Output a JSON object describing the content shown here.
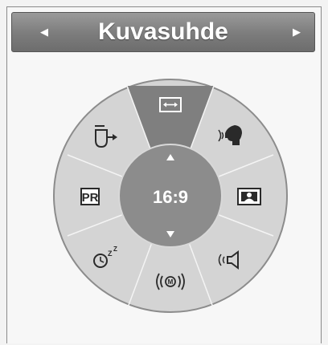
{
  "title": "Kuvasuhde",
  "nav": {
    "prev_icon": "triangle-left-icon",
    "next_icon": "triangle-right-icon"
  },
  "current_value": "16:9",
  "hub": {
    "up_icon": "triangle-up-icon",
    "down_icon": "triangle-down-icon"
  },
  "options": [
    {
      "id": "stretch",
      "icon": "stretch-arrows-icon",
      "selected": true
    },
    {
      "id": "voice",
      "icon": "speaking-head-icon",
      "selected": false
    },
    {
      "id": "portrait",
      "icon": "person-portrait-icon",
      "selected": false
    },
    {
      "id": "sound",
      "icon": "speaker-sound-icon",
      "selected": false
    },
    {
      "id": "surround",
      "icon": "m-waves-icon",
      "selected": false
    },
    {
      "id": "sleep",
      "icon": "sleep-timer-icon",
      "selected": false
    },
    {
      "id": "program",
      "label": "PR",
      "icon": "pr-box-icon",
      "selected": false
    },
    {
      "id": "input",
      "icon": "input-arrow-icon",
      "selected": false
    }
  ],
  "colors": {
    "ring_fill": "#d4d4d4",
    "ring_border": "#8c8c8c",
    "selected_wedge": "#7f7f7f",
    "hub_fill": "#8c8c8c",
    "icon": "#2a2a2a"
  }
}
